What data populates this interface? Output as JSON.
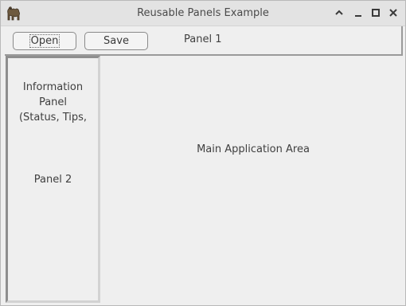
{
  "window": {
    "title": "Reusable Panels Example",
    "icon": "camel-app-icon",
    "controls": [
      "chevron-up-icon",
      "minimize-icon",
      "maximize-icon",
      "close-icon"
    ]
  },
  "toolbar": {
    "open_label": "Open",
    "save_label": "Save",
    "panel_label": "Panel 1"
  },
  "side_panel": {
    "info_text": "Information\nPanel\n(Status, Tips,",
    "panel_label": "Panel 2"
  },
  "main": {
    "label": "Main Application Area"
  }
}
